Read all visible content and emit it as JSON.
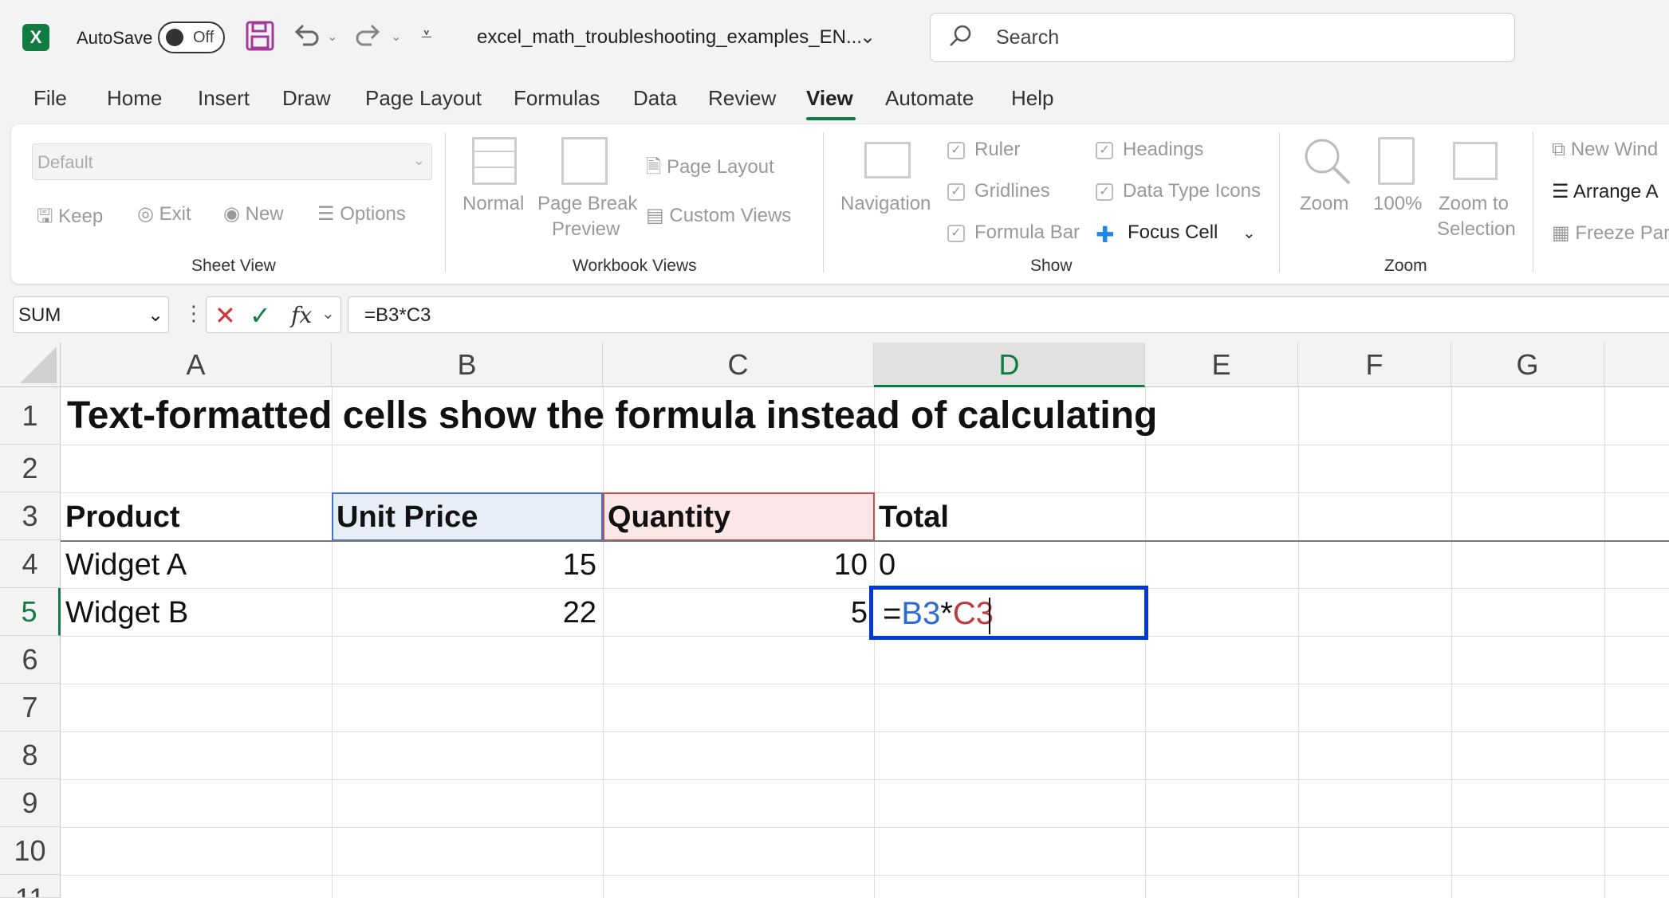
{
  "titlebar": {
    "logo_letter": "X",
    "autosave_label": "AutoSave",
    "autosave_state": "Off",
    "filename": "excel_math_troubleshooting_examples_EN...",
    "search_placeholder": "Search"
  },
  "tabs": [
    "File",
    "Home",
    "Insert",
    "Draw",
    "Page Layout",
    "Formulas",
    "Data",
    "Review",
    "View",
    "Automate",
    "Help"
  ],
  "active_tab": "View",
  "ribbon": {
    "sheet_view": {
      "dropdown_value": "Default",
      "keep": "Keep",
      "exit": "Exit",
      "new": "New",
      "options": "Options",
      "label": "Sheet View"
    },
    "workbook_views": {
      "normal": "Normal",
      "page_break_1": "Page Break",
      "page_break_2": "Preview",
      "page_layout": "Page Layout",
      "custom_views": "Custom Views",
      "label": "Workbook Views"
    },
    "show": {
      "navigation": "Navigation",
      "ruler": "Ruler",
      "gridlines": "Gridlines",
      "formula_bar": "Formula Bar",
      "headings": "Headings",
      "data_type_icons": "Data Type Icons",
      "focus_cell": "Focus Cell",
      "label": "Show"
    },
    "zoom": {
      "zoom": "Zoom",
      "hundred": "100%",
      "zoom_to_1": "Zoom to",
      "zoom_to_2": "Selection",
      "label": "Zoom"
    },
    "window": {
      "new_window": "New Wind",
      "arrange_all": "Arrange A",
      "freeze_panes": "Freeze Par"
    }
  },
  "formula_bar": {
    "name_box": "SUM",
    "formula": "=B3*C3"
  },
  "columns": [
    "A",
    "B",
    "C",
    "D",
    "E",
    "F",
    "G"
  ],
  "rows": [
    "1",
    "2",
    "3",
    "4",
    "5",
    "6",
    "7",
    "8",
    "9",
    "10",
    "11"
  ],
  "cells": {
    "A1": "Text-formatted cells show the formula instead of calculating",
    "A3": "Product",
    "B3": "Unit Price",
    "C3": "Quantity",
    "D3": "Total",
    "A4": "Widget A",
    "B4": "15",
    "C4": "10",
    "D4": "0",
    "A5": "Widget B",
    "B5": "22",
    "C5": "5"
  },
  "edit_cell": {
    "eq": "=",
    "ref1": "B3",
    "op": "*",
    "ref2": "C3"
  }
}
